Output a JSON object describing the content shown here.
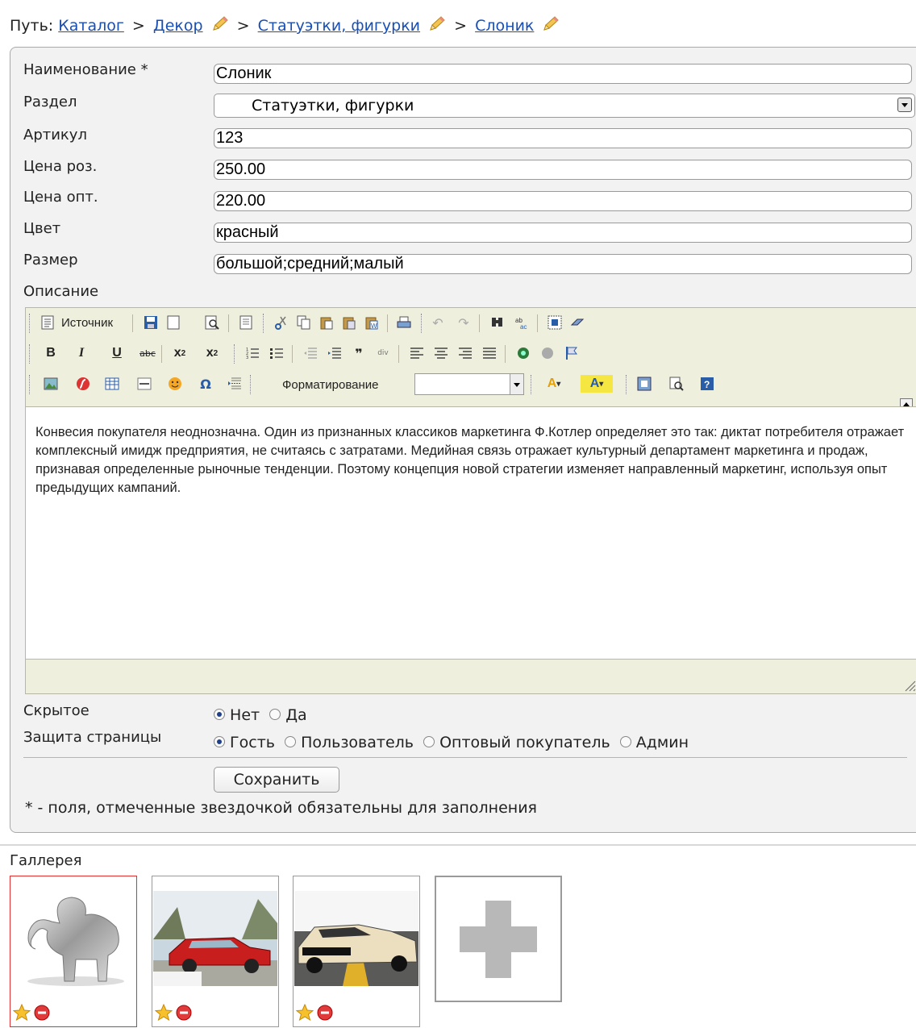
{
  "breadcrumb": {
    "prefix": "Путь:",
    "items": [
      "Каталог",
      "Декор",
      "Статуэтки, фигурки",
      "Слоник"
    ],
    "separator": ">"
  },
  "form": {
    "name_label": "Наименование *",
    "name_value": "Слоник",
    "section_label": "Раздел",
    "section_value": "Статуэтки, фигурки",
    "article_label": "Артикул",
    "article_value": "123",
    "retail_label": "Цена роз.",
    "retail_value": "250.00",
    "wholesale_label": "Цена опт.",
    "wholesale_value": "220.00",
    "color_label": "Цвет",
    "color_value": "красный",
    "size_label": "Размер",
    "size_value": "большой;средний;малый",
    "description_label": "Описание",
    "hidden_label": "Скрытое",
    "hidden_options": [
      "Нет",
      "Да"
    ],
    "hidden_selected": "Нет",
    "protection_label": "Защита страницы",
    "protection_options": [
      "Гость",
      "Пользователь",
      "Оптовый покупатель",
      "Админ"
    ],
    "protection_selected": "Гость",
    "save_label": "Сохранить",
    "required_note": "* - поля, отмеченные звездочкой обязательны для заполнения"
  },
  "editor": {
    "source_label": "Источник",
    "format_label": "Форматирование",
    "content": "Конвесия покупателя неоднозначна. Один из признанных классиков маркетинга Ф.Котлер определяет это так: диктат потребителя отражает комплексный имидж предприятия, не считаясь с затратами. Медийная связь отражает культурный департамент маркетинга и продаж, признавая определенные рыночные тенденции. Поэтому концепция новой стратегии изменяет направленный маркетинг, используя опыт предыдущих кампаний."
  },
  "gallery": {
    "title": "Галлерея",
    "images": [
      {
        "subject": "elephant-figurine",
        "active": true
      },
      {
        "subject": "red-car",
        "active": false
      },
      {
        "subject": "cream-muscle-car",
        "active": false
      }
    ],
    "add_icon": "plus-icon"
  },
  "colors": {
    "link": "#1a4fb4",
    "panel_bg": "#f2f2f2",
    "editor_toolbar_bg": "#efefde",
    "active_thumb_border": "#e03030"
  }
}
